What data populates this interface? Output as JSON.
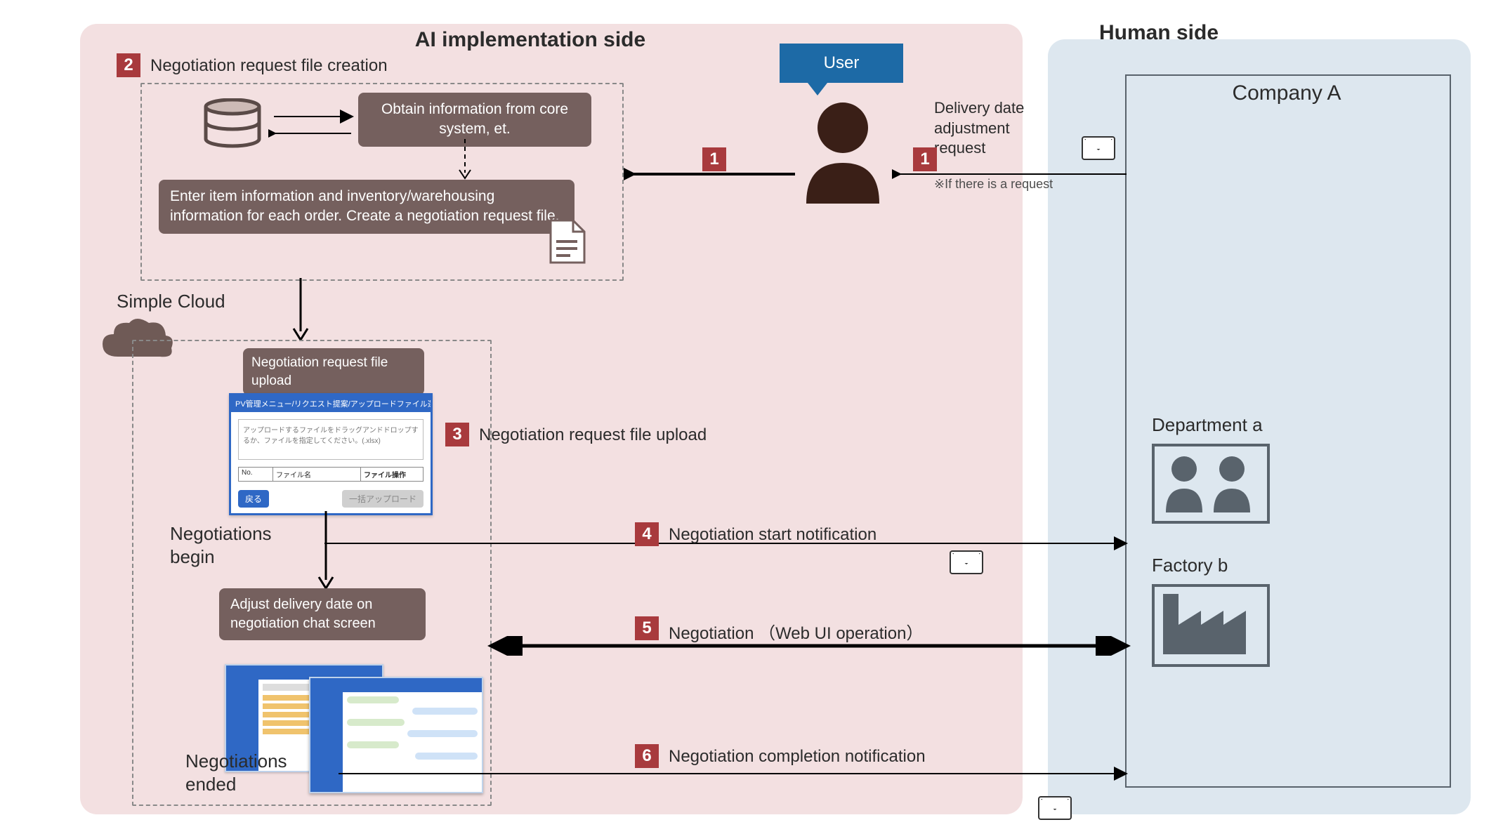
{
  "titles": {
    "ai_side": "AI implementation side",
    "human_side": "Human side",
    "company": "Company A"
  },
  "user": {
    "tag_label": "User"
  },
  "company": {
    "dept_label": "Department a",
    "factory_label": "Factory b"
  },
  "request": {
    "line1": "Delivery date",
    "line2": "adjustment",
    "line3": "request",
    "note": "※If there is a request"
  },
  "steps": {
    "s1": "1",
    "s2": "2",
    "s3": "3",
    "s4": "4",
    "s5": "5",
    "s6": "6",
    "label2": "Negotiation request file creation",
    "label3": "Negotiation request file upload",
    "label4": "Negotiation start notification",
    "label5": "Negotiation （Web UI operation）",
    "label6": "Negotiation completion notification"
  },
  "box": {
    "obtain": "Obtain information from core system, et.",
    "enter": "Enter item information and inventory/warehousing information for each order. Create a negotiation request file.",
    "upload": "Negotiation request file upload",
    "adjust": "Adjust delivery date on negotiation chat screen"
  },
  "cloud": {
    "label": "Simple Cloud"
  },
  "status": {
    "begin": "Negotiations begin",
    "ended": "Negotiations ended"
  },
  "mock": {
    "upload_title": "PV管理メニュー/リクエスト提案/アップロードファイル選択",
    "upload_hint": "アップロードするファイルをドラッグアンドドロップするか、ファイルを指定してください。(.xlsx)",
    "col1": "No.",
    "col2": "ファイル名",
    "col3": "ファイル操作",
    "btn_back": "戻る",
    "btn_upload": "一括アップロード"
  }
}
